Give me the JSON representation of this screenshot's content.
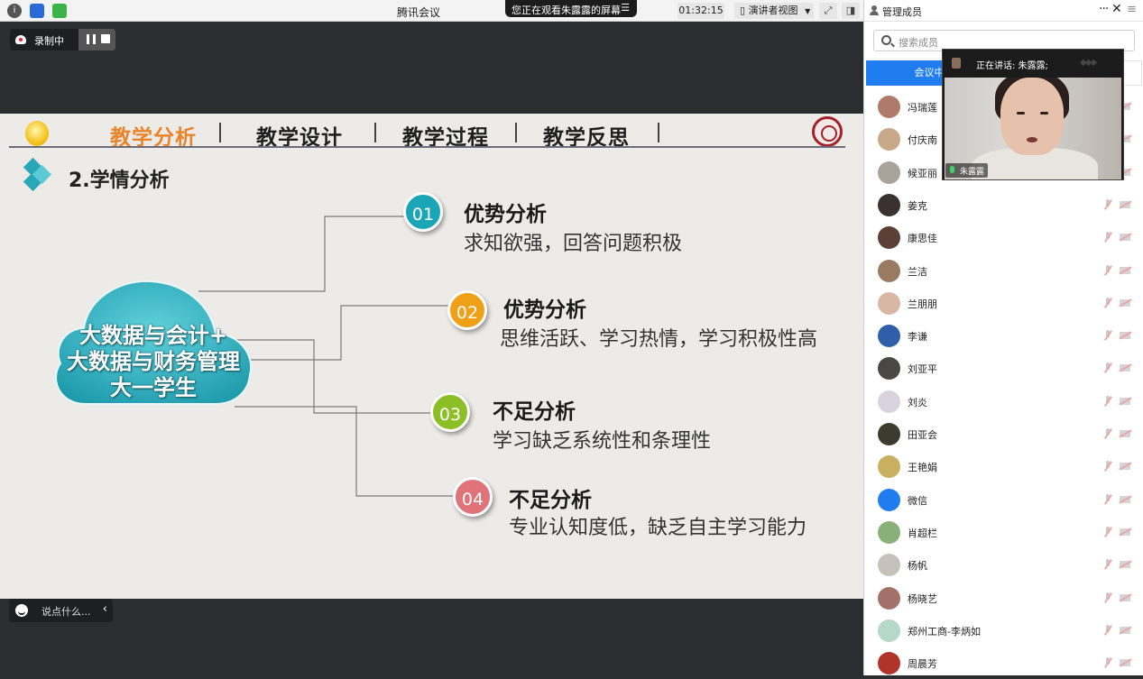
{
  "topbar": {
    "info_icon": "info-icon",
    "app_title": "腾讯会议",
    "viewing_text": "您正在观看朱露露的屏幕",
    "timer": "01:32:15",
    "view_mode": "演讲者视图"
  },
  "recording": {
    "label": "录制中"
  },
  "slide": {
    "nav": [
      {
        "label": "教学分析",
        "active": true
      },
      {
        "label": "教学设计",
        "active": false
      },
      {
        "label": "教学过程",
        "active": false
      },
      {
        "label": "教学反思",
        "active": false
      }
    ],
    "section_title": "2.学情分析",
    "cloud_lines": [
      "大数据与会计+",
      "大数据与财务管理",
      "大一学生"
    ],
    "items": [
      {
        "num": "01",
        "title": "优势分析",
        "desc": "求知欲强，回答问题积极",
        "color": "#1aa6b7"
      },
      {
        "num": "02",
        "title": "优势分析",
        "desc": "思维活跃、学习热情，学习积极性高",
        "color": "#f0a017"
      },
      {
        "num": "03",
        "title": "不足分析",
        "desc": "学习缺乏系统性和条理性",
        "color": "#8cbf26"
      },
      {
        "num": "04",
        "title": "不足分析",
        "desc": "专业认知度低，缺乏自主学习能力",
        "color": "#e0737a"
      }
    ]
  },
  "chat": {
    "placeholder": "说点什么..."
  },
  "panel": {
    "title": "管理成员",
    "search_placeholder": "搜索成员",
    "tab_active": "会议中",
    "speaking_label": "正在讲话: 朱露露;",
    "video_name": "朱露露",
    "members": [
      "冯瑞莲",
      "付庆南",
      "候亚丽",
      "姜克",
      "康思佳",
      "兰洁",
      "兰朋朋",
      "李谦",
      "刘亚平",
      "刘炎",
      "田亚会",
      "王艳娟",
      "微信",
      "肖超栏",
      "杨帆",
      "杨晓艺",
      "郑州工商-李炳如",
      "周晨芳"
    ]
  },
  "colors": {
    "accent": "#1f7df0",
    "nav_active": "#e9842a",
    "cloud": "#3ab7c4"
  }
}
